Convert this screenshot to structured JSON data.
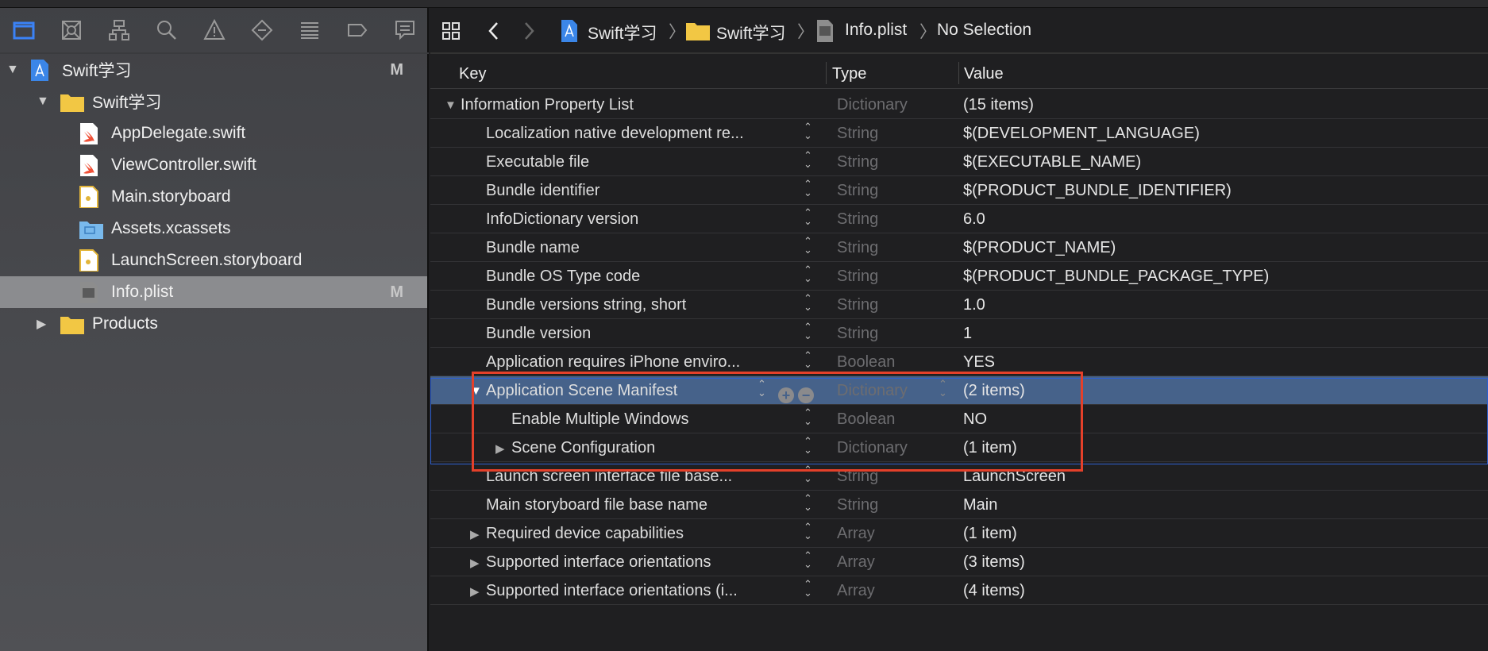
{
  "navigator": {
    "tabs": [
      "folder-icon",
      "source-control-icon",
      "hierarchy-icon",
      "search-icon",
      "warning-icon",
      "test-icon",
      "debug-icon",
      "breakpoint-icon",
      "report-icon"
    ],
    "items": [
      {
        "label": "Swift学习",
        "icon": "xcode-project-icon",
        "level": 0,
        "disclosure": "open",
        "badge": "M"
      },
      {
        "label": "Swift学习",
        "icon": "folder-icon",
        "level": 1,
        "disclosure": "open"
      },
      {
        "label": "AppDelegate.swift",
        "icon": "swift-file-icon",
        "level": 2
      },
      {
        "label": "ViewController.swift",
        "icon": "swift-file-icon",
        "level": 2
      },
      {
        "label": "Main.storyboard",
        "icon": "storyboard-icon",
        "level": 2
      },
      {
        "label": "Assets.xcassets",
        "icon": "assets-folder-icon",
        "level": 2
      },
      {
        "label": "LaunchScreen.storyboard",
        "icon": "storyboard-icon",
        "level": 2
      },
      {
        "label": "Info.plist",
        "icon": "plist-file-icon",
        "level": 2,
        "badge": "M",
        "selected": true
      },
      {
        "label": "Products",
        "icon": "folder-icon",
        "level": 1,
        "disclosure": "closed"
      }
    ]
  },
  "jumpbar": {
    "crumbs": [
      "Swift学习",
      "Swift学习",
      "Info.plist",
      "No Selection"
    ]
  },
  "table": {
    "headers": {
      "key": "Key",
      "type": "Type",
      "value": "Value"
    },
    "rows": [
      {
        "key": "Information Property List",
        "type": "Dictionary",
        "value": "(15 items)",
        "level": 0,
        "disclosure": "open"
      },
      {
        "key": "Localization native development re...",
        "type": "String",
        "value": "$(DEVELOPMENT_LANGUAGE)",
        "level": 1
      },
      {
        "key": "Executable file",
        "type": "String",
        "value": "$(EXECUTABLE_NAME)",
        "level": 1
      },
      {
        "key": "Bundle identifier",
        "type": "String",
        "value": "$(PRODUCT_BUNDLE_IDENTIFIER)",
        "level": 1
      },
      {
        "key": "InfoDictionary version",
        "type": "String",
        "value": "6.0",
        "level": 1
      },
      {
        "key": "Bundle name",
        "type": "String",
        "value": "$(PRODUCT_NAME)",
        "level": 1
      },
      {
        "key": "Bundle OS Type code",
        "type": "String",
        "value": "$(PRODUCT_BUNDLE_PACKAGE_TYPE)",
        "level": 1
      },
      {
        "key": "Bundle versions string, short",
        "type": "String",
        "value": "1.0",
        "level": 1
      },
      {
        "key": "Bundle version",
        "type": "String",
        "value": "1",
        "level": 1
      },
      {
        "key": "Application requires iPhone enviro...",
        "type": "Boolean",
        "value": "YES",
        "level": 1
      },
      {
        "key": "Application Scene Manifest",
        "type": "Dictionary",
        "value": "(2 items)",
        "level": 1,
        "disclosure": "open",
        "selected": true
      },
      {
        "key": "Enable Multiple Windows",
        "type": "Boolean",
        "value": "NO",
        "level": 2
      },
      {
        "key": "Scene Configuration",
        "type": "Dictionary",
        "value": "(1 item)",
        "level": 2,
        "disclosure": "closed"
      },
      {
        "key": "Launch screen interface file base...",
        "type": "String",
        "value": "LaunchScreen",
        "level": 1
      },
      {
        "key": "Main storyboard file base name",
        "type": "String",
        "value": "Main",
        "level": 1
      },
      {
        "key": "Required device capabilities",
        "type": "Array",
        "value": "(1 item)",
        "level": 1,
        "disclosure": "closed"
      },
      {
        "key": "Supported interface orientations",
        "type": "Array",
        "value": "(3 items)",
        "level": 1,
        "disclosure": "closed"
      },
      {
        "key": "Supported interface orientations (i...",
        "type": "Array",
        "value": "(4 items)",
        "level": 1,
        "disclosure": "closed"
      }
    ]
  },
  "colors": {
    "selection": "#46628a",
    "highlight_box": "#e4402a",
    "focus_border": "#2d5fd1"
  }
}
